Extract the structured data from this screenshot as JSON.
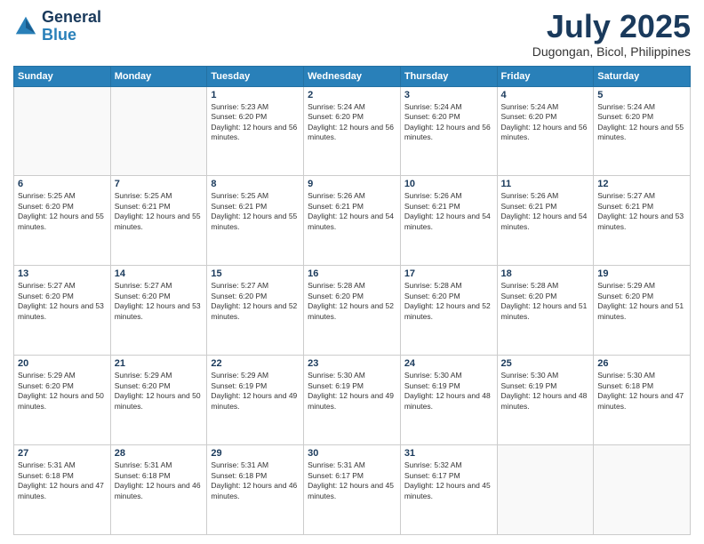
{
  "header": {
    "logo_general": "General",
    "logo_blue": "Blue",
    "month": "July 2025",
    "location": "Dugongan, Bicol, Philippines"
  },
  "days_of_week": [
    "Sunday",
    "Monday",
    "Tuesday",
    "Wednesday",
    "Thursday",
    "Friday",
    "Saturday"
  ],
  "weeks": [
    [
      {
        "day": "",
        "sunrise": "",
        "sunset": "",
        "daylight": ""
      },
      {
        "day": "",
        "sunrise": "",
        "sunset": "",
        "daylight": ""
      },
      {
        "day": "1",
        "sunrise": "Sunrise: 5:23 AM",
        "sunset": "Sunset: 6:20 PM",
        "daylight": "Daylight: 12 hours and 56 minutes."
      },
      {
        "day": "2",
        "sunrise": "Sunrise: 5:24 AM",
        "sunset": "Sunset: 6:20 PM",
        "daylight": "Daylight: 12 hours and 56 minutes."
      },
      {
        "day": "3",
        "sunrise": "Sunrise: 5:24 AM",
        "sunset": "Sunset: 6:20 PM",
        "daylight": "Daylight: 12 hours and 56 minutes."
      },
      {
        "day": "4",
        "sunrise": "Sunrise: 5:24 AM",
        "sunset": "Sunset: 6:20 PM",
        "daylight": "Daylight: 12 hours and 56 minutes."
      },
      {
        "day": "5",
        "sunrise": "Sunrise: 5:24 AM",
        "sunset": "Sunset: 6:20 PM",
        "daylight": "Daylight: 12 hours and 55 minutes."
      }
    ],
    [
      {
        "day": "6",
        "sunrise": "Sunrise: 5:25 AM",
        "sunset": "Sunset: 6:20 PM",
        "daylight": "Daylight: 12 hours and 55 minutes."
      },
      {
        "day": "7",
        "sunrise": "Sunrise: 5:25 AM",
        "sunset": "Sunset: 6:21 PM",
        "daylight": "Daylight: 12 hours and 55 minutes."
      },
      {
        "day": "8",
        "sunrise": "Sunrise: 5:25 AM",
        "sunset": "Sunset: 6:21 PM",
        "daylight": "Daylight: 12 hours and 55 minutes."
      },
      {
        "day": "9",
        "sunrise": "Sunrise: 5:26 AM",
        "sunset": "Sunset: 6:21 PM",
        "daylight": "Daylight: 12 hours and 54 minutes."
      },
      {
        "day": "10",
        "sunrise": "Sunrise: 5:26 AM",
        "sunset": "Sunset: 6:21 PM",
        "daylight": "Daylight: 12 hours and 54 minutes."
      },
      {
        "day": "11",
        "sunrise": "Sunrise: 5:26 AM",
        "sunset": "Sunset: 6:21 PM",
        "daylight": "Daylight: 12 hours and 54 minutes."
      },
      {
        "day": "12",
        "sunrise": "Sunrise: 5:27 AM",
        "sunset": "Sunset: 6:21 PM",
        "daylight": "Daylight: 12 hours and 53 minutes."
      }
    ],
    [
      {
        "day": "13",
        "sunrise": "Sunrise: 5:27 AM",
        "sunset": "Sunset: 6:20 PM",
        "daylight": "Daylight: 12 hours and 53 minutes."
      },
      {
        "day": "14",
        "sunrise": "Sunrise: 5:27 AM",
        "sunset": "Sunset: 6:20 PM",
        "daylight": "Daylight: 12 hours and 53 minutes."
      },
      {
        "day": "15",
        "sunrise": "Sunrise: 5:27 AM",
        "sunset": "Sunset: 6:20 PM",
        "daylight": "Daylight: 12 hours and 52 minutes."
      },
      {
        "day": "16",
        "sunrise": "Sunrise: 5:28 AM",
        "sunset": "Sunset: 6:20 PM",
        "daylight": "Daylight: 12 hours and 52 minutes."
      },
      {
        "day": "17",
        "sunrise": "Sunrise: 5:28 AM",
        "sunset": "Sunset: 6:20 PM",
        "daylight": "Daylight: 12 hours and 52 minutes."
      },
      {
        "day": "18",
        "sunrise": "Sunrise: 5:28 AM",
        "sunset": "Sunset: 6:20 PM",
        "daylight": "Daylight: 12 hours and 51 minutes."
      },
      {
        "day": "19",
        "sunrise": "Sunrise: 5:29 AM",
        "sunset": "Sunset: 6:20 PM",
        "daylight": "Daylight: 12 hours and 51 minutes."
      }
    ],
    [
      {
        "day": "20",
        "sunrise": "Sunrise: 5:29 AM",
        "sunset": "Sunset: 6:20 PM",
        "daylight": "Daylight: 12 hours and 50 minutes."
      },
      {
        "day": "21",
        "sunrise": "Sunrise: 5:29 AM",
        "sunset": "Sunset: 6:20 PM",
        "daylight": "Daylight: 12 hours and 50 minutes."
      },
      {
        "day": "22",
        "sunrise": "Sunrise: 5:29 AM",
        "sunset": "Sunset: 6:19 PM",
        "daylight": "Daylight: 12 hours and 49 minutes."
      },
      {
        "day": "23",
        "sunrise": "Sunrise: 5:30 AM",
        "sunset": "Sunset: 6:19 PM",
        "daylight": "Daylight: 12 hours and 49 minutes."
      },
      {
        "day": "24",
        "sunrise": "Sunrise: 5:30 AM",
        "sunset": "Sunset: 6:19 PM",
        "daylight": "Daylight: 12 hours and 48 minutes."
      },
      {
        "day": "25",
        "sunrise": "Sunrise: 5:30 AM",
        "sunset": "Sunset: 6:19 PM",
        "daylight": "Daylight: 12 hours and 48 minutes."
      },
      {
        "day": "26",
        "sunrise": "Sunrise: 5:30 AM",
        "sunset": "Sunset: 6:18 PM",
        "daylight": "Daylight: 12 hours and 47 minutes."
      }
    ],
    [
      {
        "day": "27",
        "sunrise": "Sunrise: 5:31 AM",
        "sunset": "Sunset: 6:18 PM",
        "daylight": "Daylight: 12 hours and 47 minutes."
      },
      {
        "day": "28",
        "sunrise": "Sunrise: 5:31 AM",
        "sunset": "Sunset: 6:18 PM",
        "daylight": "Daylight: 12 hours and 46 minutes."
      },
      {
        "day": "29",
        "sunrise": "Sunrise: 5:31 AM",
        "sunset": "Sunset: 6:18 PM",
        "daylight": "Daylight: 12 hours and 46 minutes."
      },
      {
        "day": "30",
        "sunrise": "Sunrise: 5:31 AM",
        "sunset": "Sunset: 6:17 PM",
        "daylight": "Daylight: 12 hours and 45 minutes."
      },
      {
        "day": "31",
        "sunrise": "Sunrise: 5:32 AM",
        "sunset": "Sunset: 6:17 PM",
        "daylight": "Daylight: 12 hours and 45 minutes."
      },
      {
        "day": "",
        "sunrise": "",
        "sunset": "",
        "daylight": ""
      },
      {
        "day": "",
        "sunrise": "",
        "sunset": "",
        "daylight": ""
      }
    ]
  ]
}
